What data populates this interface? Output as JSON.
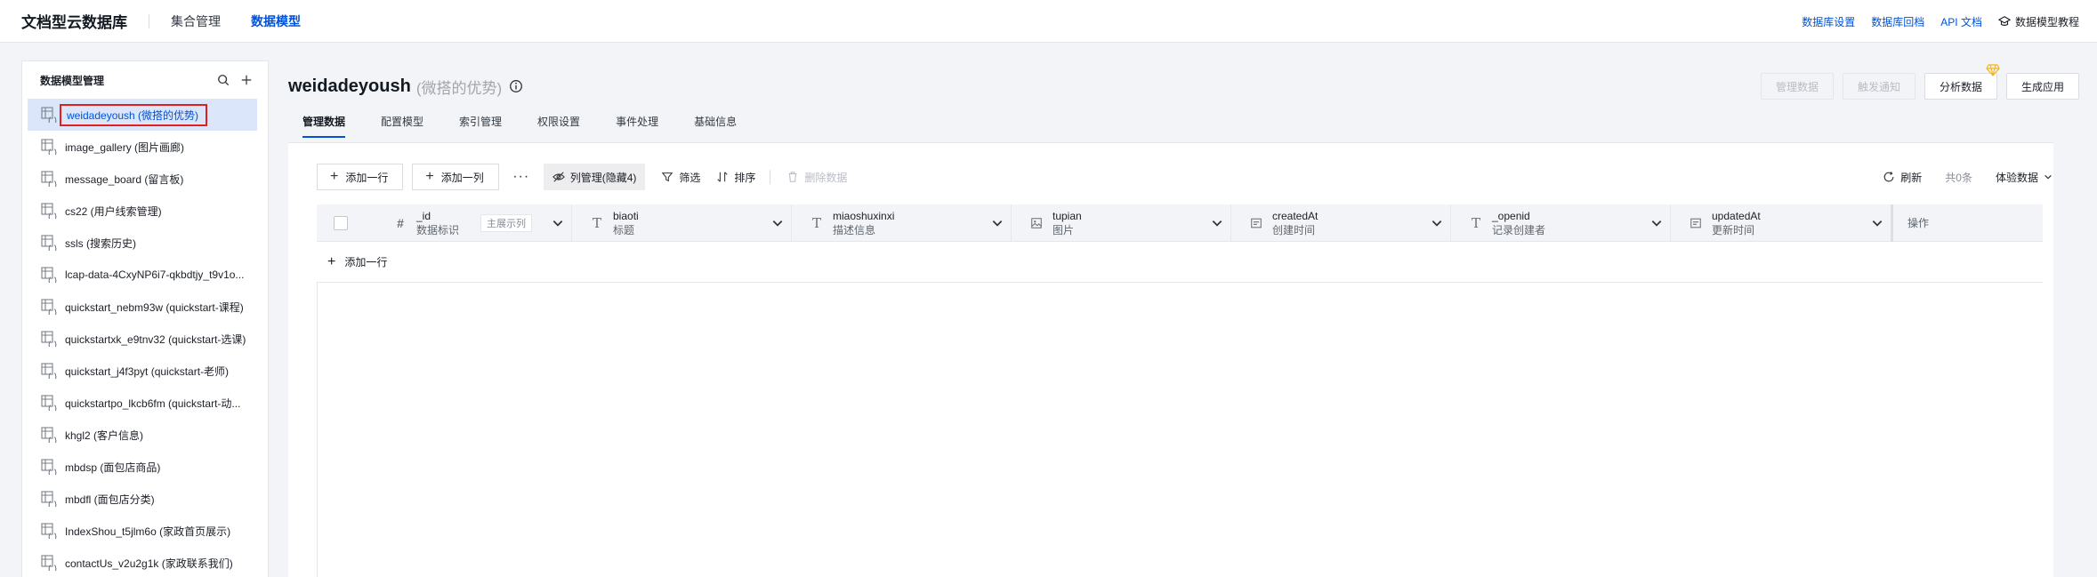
{
  "app": {
    "brand": "文档型云数据库",
    "nav": [
      {
        "label": "集合管理",
        "active": false
      },
      {
        "label": "数据模型",
        "active": true
      }
    ],
    "links": [
      "数据库设置",
      "数据库回档",
      "API 文档"
    ],
    "tutorial": "数据模型教程"
  },
  "sidebar": {
    "title": "数据模型管理",
    "items": [
      {
        "label": "weidadeyoush (微搭的优势)",
        "active": true
      },
      {
        "label": "image_gallery (图片画廊)"
      },
      {
        "label": "message_board (留言板)"
      },
      {
        "label": "cs22 (用户线索管理)"
      },
      {
        "label": "ssls (搜索历史)"
      },
      {
        "label": "lcap-data-4CxyNP6i7-qkbdtjy_t9v1o..."
      },
      {
        "label": "quickstart_nebm93w (quickstart-课程)"
      },
      {
        "label": "quickstartxk_e9tnv32 (quickstart-选课)"
      },
      {
        "label": "quickstart_j4f3pyt (quickstart-老师)"
      },
      {
        "label": "quickstartpo_lkcb6fm (quickstart-动..."
      },
      {
        "label": "khgl2 (客户信息)"
      },
      {
        "label": "mbdsp (面包店商品)"
      },
      {
        "label": "mbdfl (面包店分类)"
      },
      {
        "label": "IndexShou_t5jlm6o (家政首页展示)"
      },
      {
        "label": "contactUs_v2u2g1k (家政联系我们)"
      }
    ]
  },
  "model": {
    "name": "weidadeyoush",
    "subtitle": "(微搭的优势)",
    "actions": {
      "manage": "管理数据",
      "trigger": "触发通知",
      "analyze": "分析数据",
      "generate": "生成应用"
    }
  },
  "tabs": [
    "管理数据",
    "配置模型",
    "索引管理",
    "权限设置",
    "事件处理",
    "基础信息"
  ],
  "toolbar": {
    "add_row": "添加一行",
    "add_col": "添加一列",
    "more": "···",
    "col_manage": "列管理(隐藏4)",
    "filter": "筛选",
    "sort": "排序",
    "delete": "删除数据",
    "refresh": "刷新",
    "count": "共0条",
    "trial": "体验数据"
  },
  "table": {
    "id_col": {
      "name": "_id",
      "title": "数据标识",
      "badge": "主展示列"
    },
    "columns": [
      {
        "name": "biaoti",
        "title": "标题",
        "type": "T"
      },
      {
        "name": "miaoshuxinxi",
        "title": "描述信息",
        "type": "T"
      },
      {
        "name": "tupian",
        "title": "图片",
        "type": "image"
      },
      {
        "name": "createdAt",
        "title": "创建时间",
        "type": "date"
      },
      {
        "name": "_openid",
        "title": "记录创建者",
        "type": "T"
      },
      {
        "name": "updatedAt",
        "title": "更新时间",
        "type": "date"
      }
    ],
    "op_header": "操作",
    "add_row": "添加一行"
  }
}
